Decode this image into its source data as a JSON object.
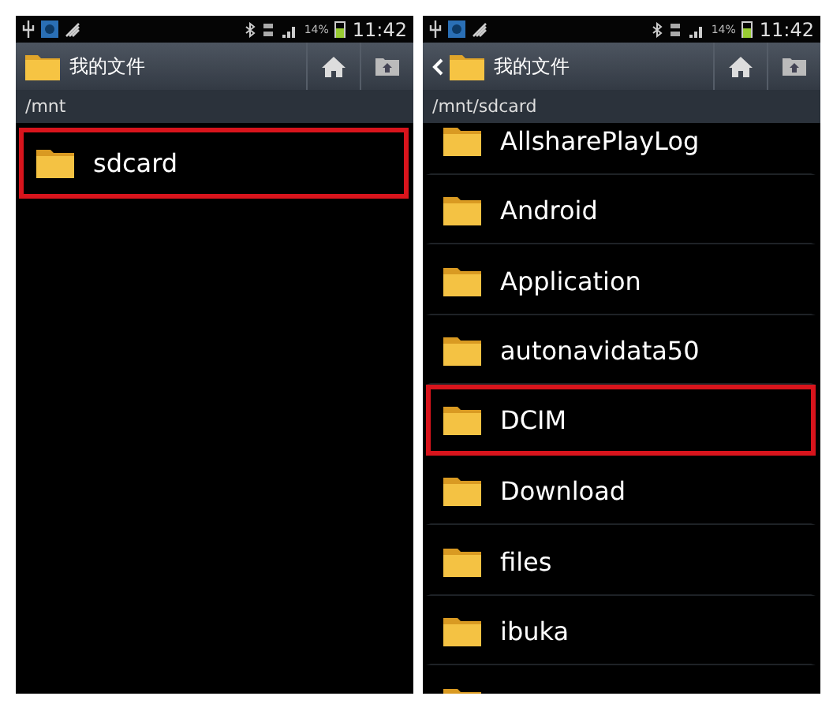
{
  "screens": [
    {
      "status": {
        "battery": "14%",
        "time": "11:42"
      },
      "back": false,
      "title": "我的文件",
      "path": "/mnt",
      "scrolled": false,
      "items": [
        {
          "name": "sdcard",
          "highlighted": true
        }
      ]
    },
    {
      "status": {
        "battery": "14%",
        "time": "11:42"
      },
      "back": true,
      "title": "我的文件",
      "path": "/mnt/sdcard",
      "scrolled": true,
      "items": [
        {
          "name": "AllsharePlayLog",
          "highlighted": false
        },
        {
          "name": "Android",
          "highlighted": false
        },
        {
          "name": "Application",
          "highlighted": false
        },
        {
          "name": "autonavidata50",
          "highlighted": false
        },
        {
          "name": "DCIM",
          "highlighted": true
        },
        {
          "name": "Download",
          "highlighted": false
        },
        {
          "name": "files",
          "highlighted": false
        },
        {
          "name": "ibuka",
          "highlighted": false
        }
      ]
    }
  ]
}
